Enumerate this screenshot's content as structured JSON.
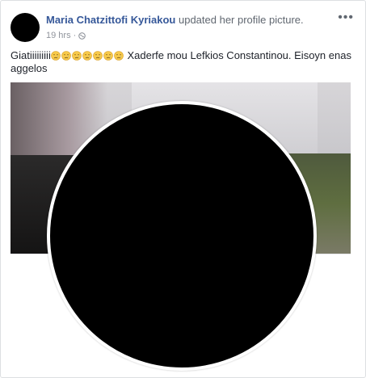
{
  "post": {
    "author": "Maria Chatzittofi Kyriakou",
    "action": "updated her profile picture.",
    "timestamp": "19 hrs",
    "separator": "·",
    "privacy_icon": "globe-icon",
    "more_icon": "ellipsis-icon",
    "text_prefix": "Giatiiiiiiiii",
    "emojis": [
      "crying-face-icon",
      "crying-face-icon",
      "crying-face-icon",
      "crying-face-icon",
      "crying-face-icon",
      "crying-face-icon",
      "crying-face-icon"
    ],
    "text_suffix": " Xaderfe mou Lefkios Constantinou. Eisoyn enas aggelos"
  },
  "colors": {
    "author": "#365899",
    "meta": "#90949c",
    "text": "#1d2129",
    "border": "#dddfe2"
  }
}
